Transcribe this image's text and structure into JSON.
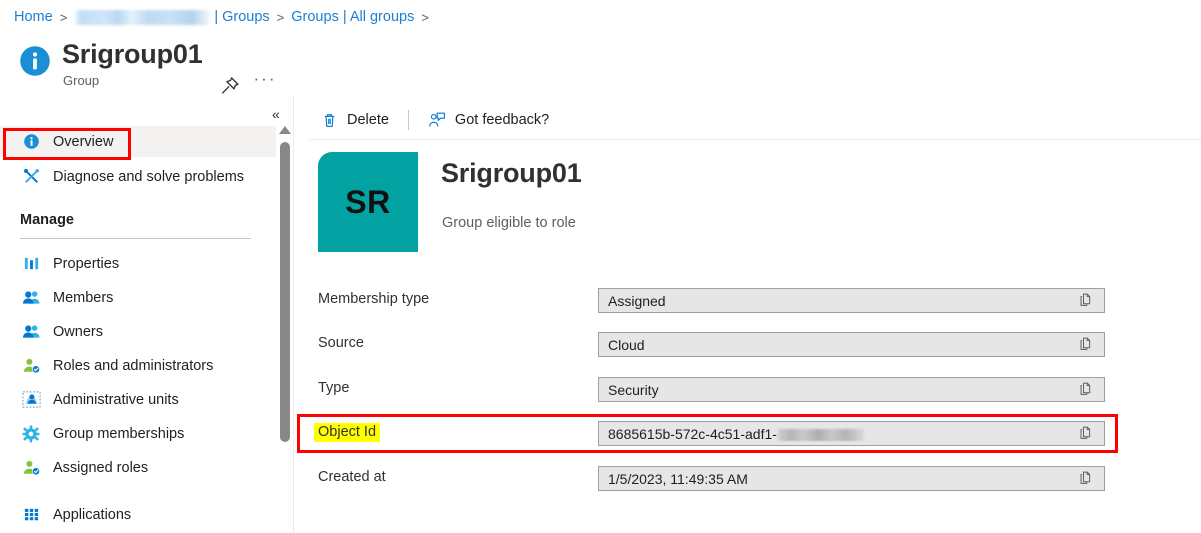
{
  "breadcrumb": {
    "home": "Home",
    "redacted_tenant": "",
    "tenant_suffix": "| Groups",
    "all_groups": "Groups | All groups",
    "separator": ">"
  },
  "header": {
    "title": "Srigroup01",
    "subtitle": "Group",
    "pin_icon": "pin-icon",
    "more_icon": "ellipsis-icon",
    "info_icon": "info-icon",
    "more_label": "···"
  },
  "left_nav": {
    "collapse_label": "«",
    "section_manage": "Manage",
    "items": [
      {
        "label": "Overview",
        "icon": "info-icon",
        "selected": true
      },
      {
        "label": "Diagnose and solve problems",
        "icon": "wrench-screwdriver-icon",
        "selected": false
      }
    ],
    "manage_items": [
      {
        "label": "Properties",
        "icon": "properties-bars-icon"
      },
      {
        "label": "Members",
        "icon": "members-people-icon"
      },
      {
        "label": "Owners",
        "icon": "owners-people-icon"
      },
      {
        "label": "Roles and administrators",
        "icon": "role-person-icon"
      },
      {
        "label": "Administrative units",
        "icon": "administrative-units-icon"
      },
      {
        "label": "Group memberships",
        "icon": "gear-icon"
      },
      {
        "label": "Assigned roles",
        "icon": "assigned-role-person-icon"
      },
      {
        "label": "Applications",
        "icon": "apps-grid-icon"
      }
    ]
  },
  "command_bar": {
    "delete_label": "Delete",
    "delete_icon": "trash-icon",
    "feedback_label": "Got feedback?",
    "feedback_icon": "feedback-person-icon"
  },
  "identity": {
    "initials": "SR",
    "name": "Srigroup01",
    "description": "Group eligible to role"
  },
  "properties": [
    {
      "label": "Membership type",
      "value": "Assigned",
      "copy_icon": "copy-icon",
      "redacted": false,
      "highlighted": false
    },
    {
      "label": "Source",
      "value": "Cloud",
      "copy_icon": "copy-icon",
      "redacted": false,
      "highlighted": false
    },
    {
      "label": "Type",
      "value": "Security",
      "copy_icon": "copy-icon",
      "redacted": false,
      "highlighted": false
    },
    {
      "label": "Object Id",
      "value": "8685615b-572c-4c51-adf1-",
      "copy_icon": "copy-icon",
      "redacted": true,
      "highlighted": true
    },
    {
      "label": "Created at",
      "value": "1/5/2023, 11:49:35 AM",
      "copy_icon": "copy-icon",
      "redacted": false,
      "highlighted": false
    }
  ],
  "annotations": {
    "highlight_color": "#ffff00",
    "box_color": "#ff0000",
    "accent_teal": "#03a2a2",
    "link_color": "#1a7fd4"
  }
}
